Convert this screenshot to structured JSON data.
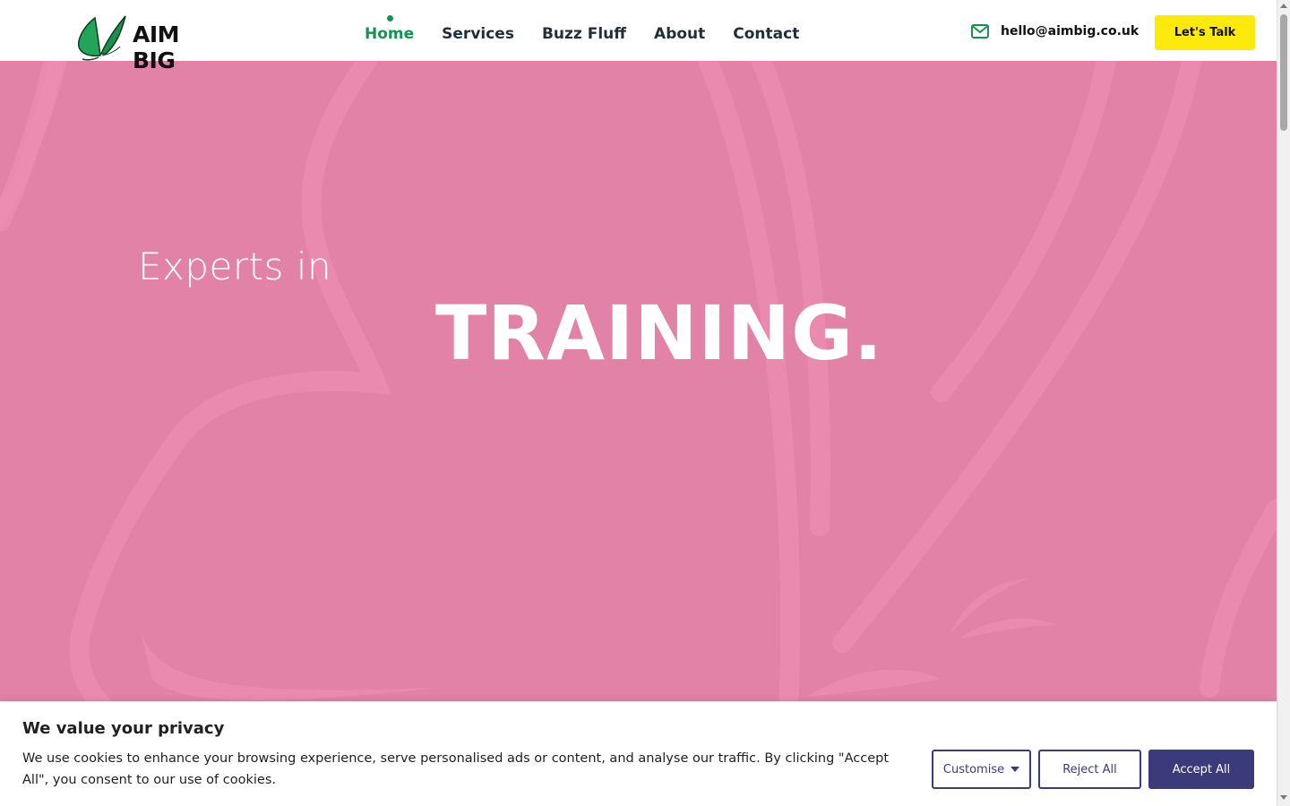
{
  "header": {
    "logo_text": "AIM BIG",
    "nav": [
      {
        "label": "Home",
        "active": true
      },
      {
        "label": "Services",
        "active": false
      },
      {
        "label": "Buzz Fluff",
        "active": false
      },
      {
        "label": "About",
        "active": false
      },
      {
        "label": "Contact",
        "active": false
      }
    ],
    "email": "hello@aimbig.co.uk",
    "email_icon": "envelope-icon",
    "cta_label": "Let's Talk"
  },
  "hero": {
    "subtitle": "Experts in",
    "title": "TRAINING."
  },
  "cookie": {
    "title": "We value your privacy",
    "text": "We use cookies to enhance your browsing experience, serve personalised ads or content, and analyse our traffic. By clicking \"Accept All\", you consent to our use of cookies.",
    "customise_label": "Customise",
    "reject_label": "Reject All",
    "accept_label": "Accept All"
  },
  "colors": {
    "brand_green": "#13954f",
    "hero_pink": "#e282a6",
    "cta_yellow": "#fde90b",
    "cookie_purple": "#3b3a7a",
    "nav_dark": "#1f2f3a"
  }
}
